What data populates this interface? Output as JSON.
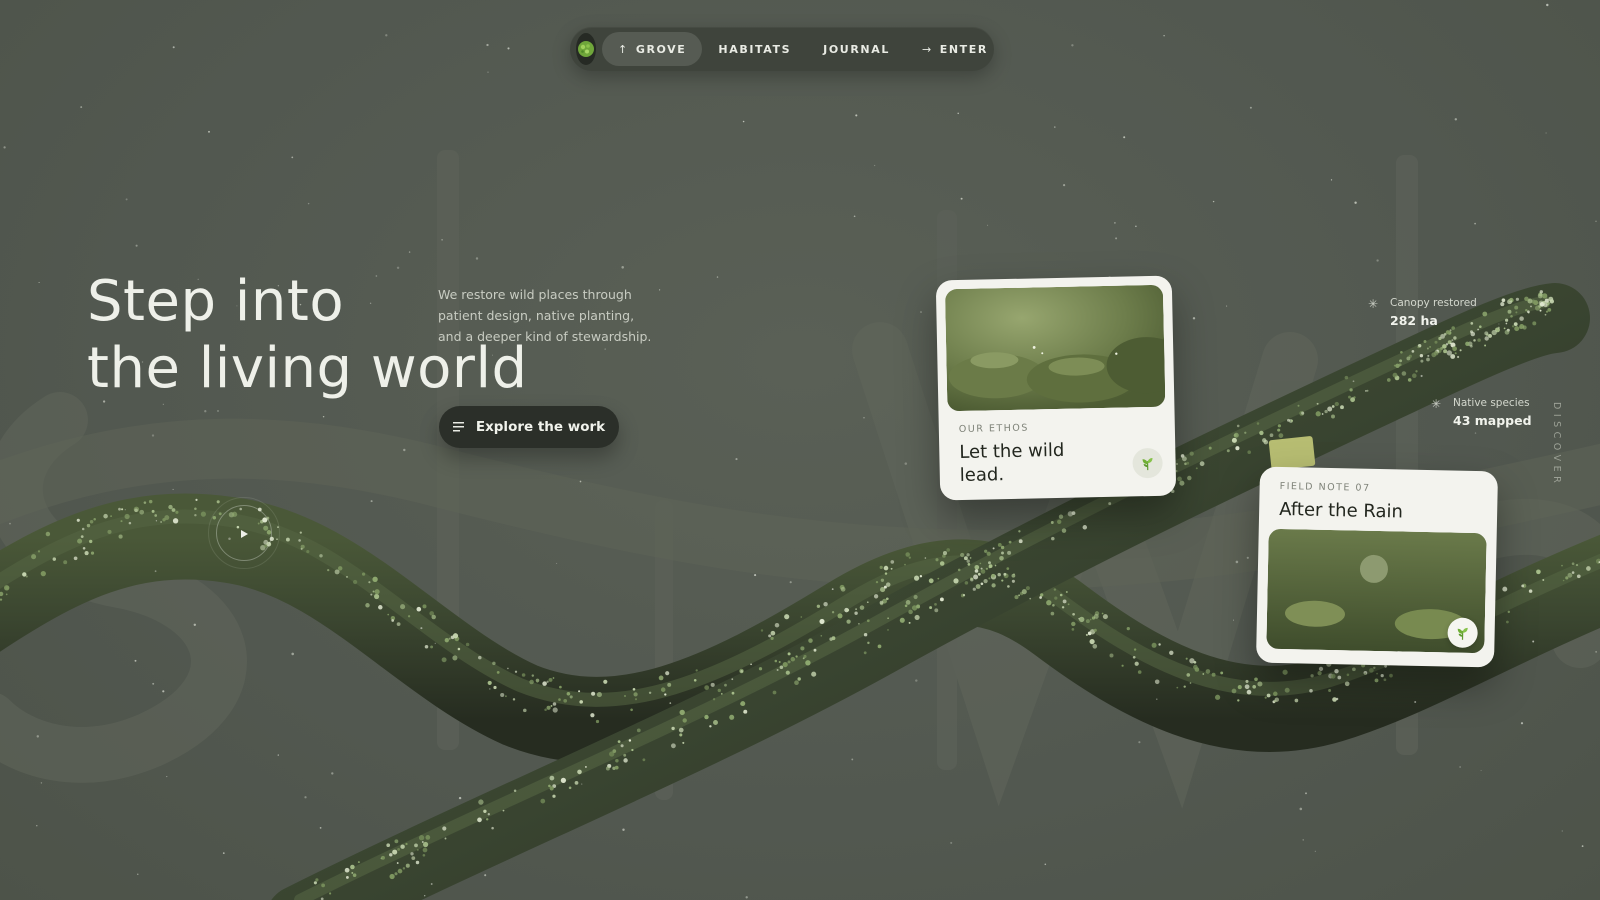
{
  "nav": {
    "logo_icon": "tree-globe-icon",
    "items": [
      {
        "label": "GROVE",
        "icon": "arrow-up-icon",
        "active": true
      },
      {
        "label": "HABITATS"
      },
      {
        "label": "JOURNAL"
      },
      {
        "label": "ENTER",
        "icon": "arrow-right-icon"
      }
    ]
  },
  "hero": {
    "title_line1": "Step into",
    "title_line2": "the living world",
    "copy_line1": "We restore wild places through",
    "copy_line2": "patient design, native planting,",
    "copy_line3": "and a deeper kind of stewardship.",
    "cta_label": "Explore the work",
    "cta_icon": "menu-lines-icon",
    "play_icon": "play-icon"
  },
  "cards": {
    "ethos": {
      "eyebrow": "OUR ETHOS",
      "title_line1": "Let the wild",
      "title_line2": "lead.",
      "icon": "leaf-icon"
    },
    "field_note": {
      "eyebrow": "FIELD NOTE 07",
      "title": "After the Rain",
      "icon": "leaf-icon"
    }
  },
  "stats": [
    {
      "label": "Canopy restored",
      "value": "282 ha",
      "icon": "asterisk-icon"
    },
    {
      "label": "Native species",
      "value": "43 mapped",
      "icon": "asterisk-icon"
    }
  ],
  "side_label": "DISCOVER",
  "colors": {
    "background": "#555b51",
    "card": "#f3f3ee",
    "vine_dark": "#3a4230",
    "vine_moss": "#9fb685",
    "nav": "#3f443c"
  }
}
